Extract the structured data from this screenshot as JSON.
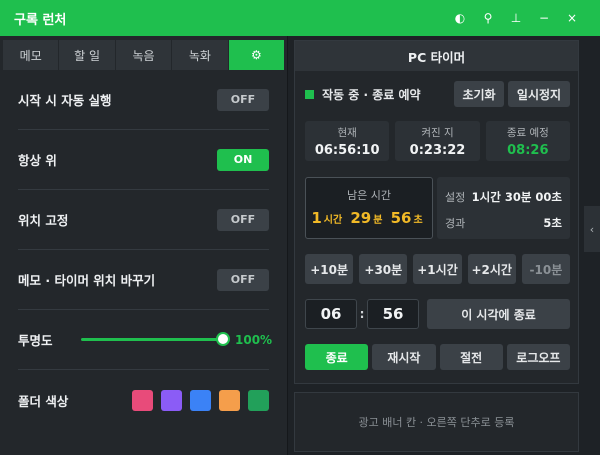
{
  "window": {
    "title": "구록 런처",
    "icons": [
      {
        "name": "theme-icon",
        "glyph": "◐"
      },
      {
        "name": "location-pin-icon",
        "glyph": "⚲"
      },
      {
        "name": "pin-icon",
        "glyph": "⊥"
      },
      {
        "name": "minimize-icon",
        "glyph": "−"
      },
      {
        "name": "close-icon",
        "glyph": "×"
      }
    ]
  },
  "tabs": [
    {
      "label": "메모"
    },
    {
      "label": "할 일"
    },
    {
      "label": "녹음"
    },
    {
      "label": "녹화"
    },
    {
      "label": "⚙",
      "icon": "gear-icon",
      "active": true
    }
  ],
  "settings": {
    "autostart": {
      "label": "시작 시 자동 실행",
      "state": "OFF"
    },
    "always_on_top": {
      "label": "항상 위",
      "state": "ON"
    },
    "lock_position": {
      "label": "위치 고정",
      "state": "OFF"
    },
    "swap_position": {
      "label": "메모 · 타이머 위치 바꾸기",
      "state": "OFF"
    },
    "opacity": {
      "label": "투명도",
      "value_text": "100%",
      "value": 100
    },
    "folder_color": {
      "label": "폴더 색상",
      "colors": [
        "#e84b7a",
        "#8b5cf6",
        "#3b82f6",
        "#f59e4b",
        "#22a05a"
      ]
    }
  },
  "timer": {
    "header": "PC 타이머",
    "status": "작동 중 · 종료 예약",
    "reset_label": "초기화",
    "pause_label": "일시정지",
    "now": {
      "label": "현재",
      "value": "06:56:10"
    },
    "elapsed_on": {
      "label": "켜진 지",
      "value": "0:23:22"
    },
    "scheduled": {
      "label": "종료 예정",
      "value": "08:26"
    },
    "remaining": {
      "label": "남은 시간",
      "hours": "1",
      "hours_unit": "시간",
      "minutes": "29",
      "minutes_unit": "분",
      "seconds": "56",
      "seconds_unit": "초"
    },
    "setting": {
      "label": "설정",
      "value": "1시간 30분 00초"
    },
    "elapsed": {
      "label": "경과",
      "value": "5초"
    },
    "quick": [
      "+10분",
      "+30분",
      "+1시간",
      "+2시간",
      "-10분"
    ],
    "target": {
      "hour": "06",
      "colon": ":",
      "minute": "56",
      "button": "이 시각에 종료"
    },
    "actions": [
      {
        "label": "종료",
        "active": true
      },
      {
        "label": "재시작"
      },
      {
        "label": "절전"
      },
      {
        "label": "로그오프"
      }
    ]
  },
  "ad": {
    "text": "광고 배너 칸 · 오른쪽 단추로 등록"
  },
  "collapse": {
    "glyph": "‹"
  },
  "colors": {
    "accent": "#1fbf4e",
    "remaining": "#f1b927",
    "panel": "#23272b",
    "background": "#1e2226"
  }
}
